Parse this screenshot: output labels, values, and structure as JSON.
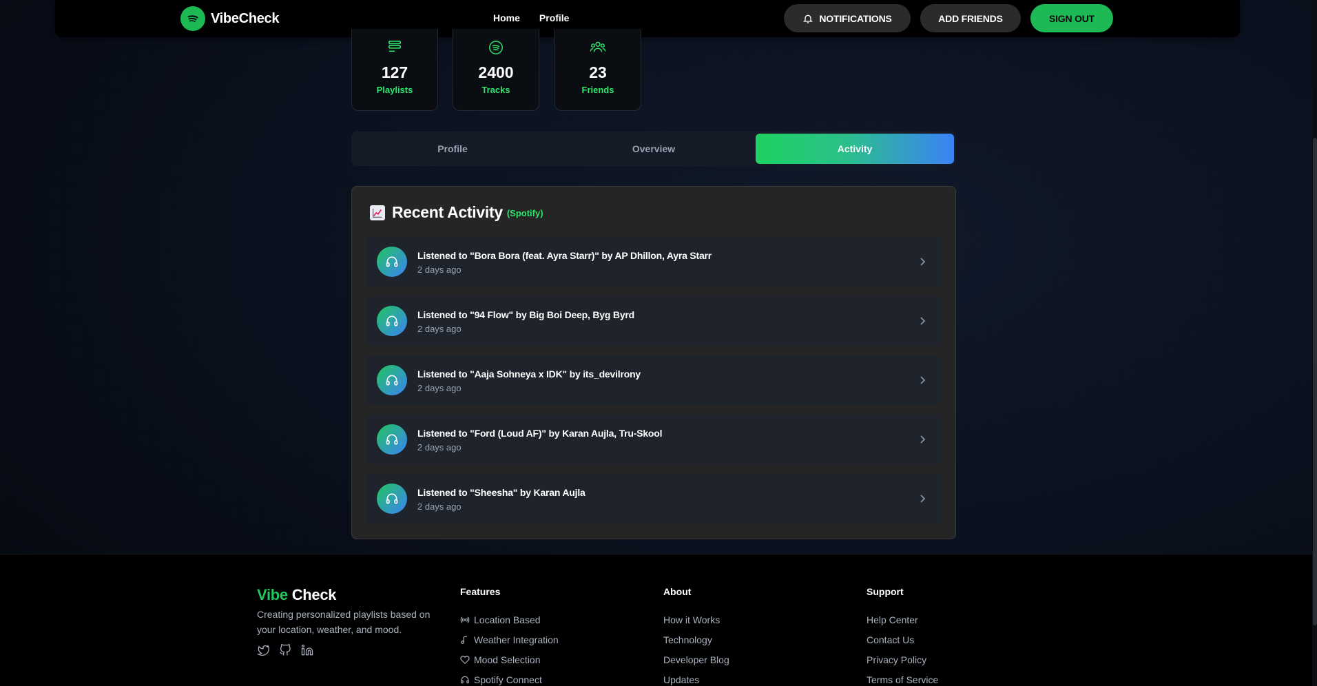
{
  "nav": {
    "brand": "VibeCheck",
    "links": [
      "Home",
      "Profile"
    ],
    "notifications_label": "NOTIFICATIONS",
    "add_friends_label": "ADD FRIENDS",
    "sign_out_label": "SIGN OUT"
  },
  "stats": [
    {
      "value": "127",
      "label": "Playlists",
      "icon": "playlist-icon"
    },
    {
      "value": "2400",
      "label": "Tracks",
      "icon": "spotify-icon"
    },
    {
      "value": "23",
      "label": "Friends",
      "icon": "friends-icon"
    }
  ],
  "tabs": {
    "items": [
      "Profile",
      "Overview",
      "Activity"
    ],
    "active": "Activity"
  },
  "activity": {
    "title": "Recent Activity",
    "subtitle": "(Spotify)",
    "items": [
      {
        "text": "Listened to \"Bora Bora (feat. Ayra Starr)\" by AP Dhillon, Ayra Starr",
        "time": "2 days ago"
      },
      {
        "text": "Listened to \"94 Flow\" by Big Boi Deep, Byg Byrd",
        "time": "2 days ago"
      },
      {
        "text": "Listened to \"Aaja Sohneya x IDK\" by its_devilrony",
        "time": "2 days ago"
      },
      {
        "text": "Listened to \"Ford (Loud AF)\" by Karan Aujla, Tru-Skool",
        "time": "2 days ago"
      },
      {
        "text": "Listened to \"Sheesha\" by Karan Aujla",
        "time": "2 days ago"
      }
    ]
  },
  "footer": {
    "brand_first": "Vibe",
    "brand_second": "Check",
    "description": "Creating personalized playlists based on your location, weather, and mood.",
    "social_icons": [
      "twitter-icon",
      "github-icon",
      "linkedin-icon"
    ],
    "columns": [
      {
        "heading": "Features",
        "links": [
          "Location Based",
          "Weather Integration",
          "Mood Selection",
          "Spotify Connect"
        ]
      },
      {
        "heading": "About",
        "links": [
          "How it Works",
          "Technology",
          "Developer Blog",
          "Updates"
        ]
      },
      {
        "heading": "Support",
        "links": [
          "Help Center",
          "Contact Us",
          "Privacy Policy",
          "Terms of Service"
        ]
      }
    ]
  },
  "colors": {
    "accent_green": "#1db954",
    "label_green": "#2ee66b",
    "accent_blue": "#3b82f6"
  }
}
